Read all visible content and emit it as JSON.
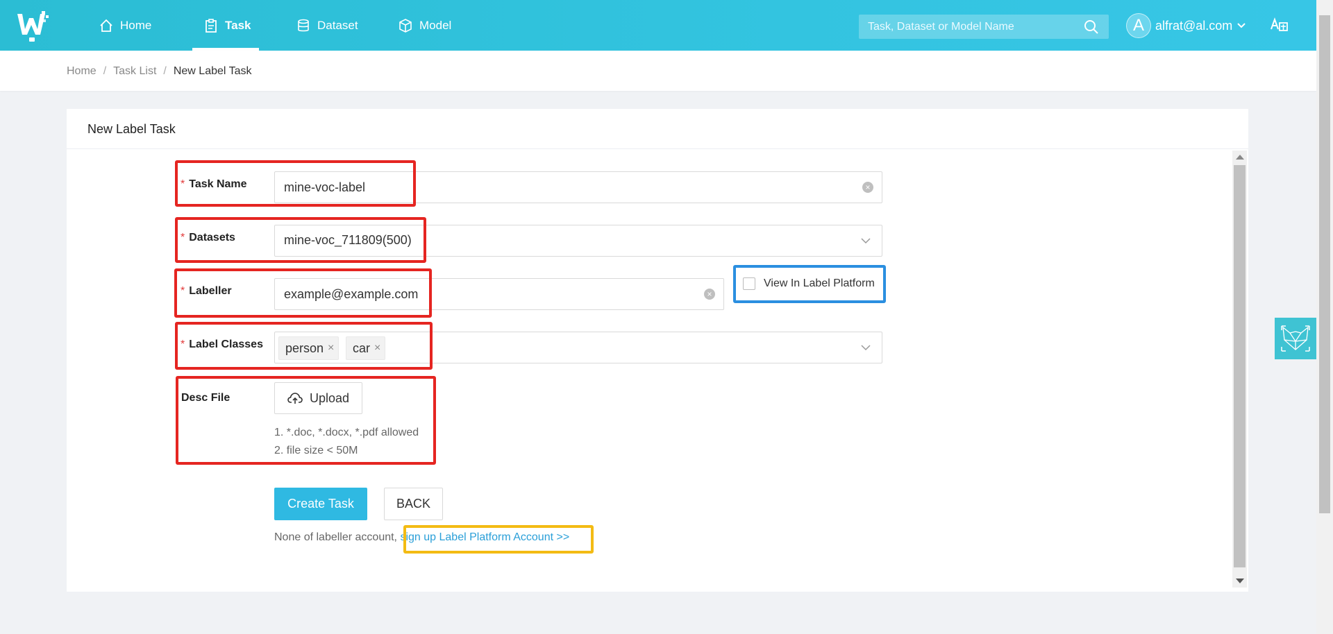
{
  "header": {
    "nav": [
      {
        "label": "Home",
        "icon": "home-icon"
      },
      {
        "label": "Task",
        "icon": "clipboard-icon",
        "active": true
      },
      {
        "label": "Dataset",
        "icon": "database-icon"
      },
      {
        "label": "Model",
        "icon": "cube-icon"
      }
    ],
    "search_placeholder": "Task, Dataset or Model Name",
    "user": {
      "avatar_letter": "A",
      "email": "alfrat@al.com"
    }
  },
  "breadcrumb": {
    "items": [
      "Home",
      "Task List",
      "New Label Task"
    ],
    "separator": "/"
  },
  "card": {
    "title": "New Label Task",
    "form": {
      "task_name": {
        "label": "Task Name",
        "value": "mine-voc-label",
        "required_mark": "*"
      },
      "datasets": {
        "label": "Datasets",
        "value": "mine-voc_711809(500)",
        "required_mark": "*"
      },
      "labeller": {
        "label": "Labeller",
        "value": "example@example.com",
        "required_mark": "*"
      },
      "view_in_label_platform": {
        "label": "View In Label Platform",
        "checked": false
      },
      "label_classes": {
        "label": "Label Classes",
        "tags": [
          "person",
          "car"
        ],
        "remove_glyph": "×",
        "required_mark": "*"
      },
      "desc_file": {
        "label": "Desc File",
        "upload_label": "Upload",
        "hints": [
          "1. *.doc, *.docx, *.pdf allowed",
          "2. file size < 50M"
        ]
      }
    },
    "actions": {
      "create": "Create Task",
      "back": "BACK"
    },
    "footer_note": {
      "text": "None of labeller account,",
      "link": "sign up Label Platform Account >>"
    }
  },
  "colors": {
    "header_gradient": "#33c4e0",
    "primary": "#2fb9e2",
    "link": "#2a9fd8",
    "required": "#e23b3b",
    "highlight_red": "#e52521",
    "highlight_blue": "#2b8fe0",
    "highlight_yellow": "#f3bb14"
  }
}
